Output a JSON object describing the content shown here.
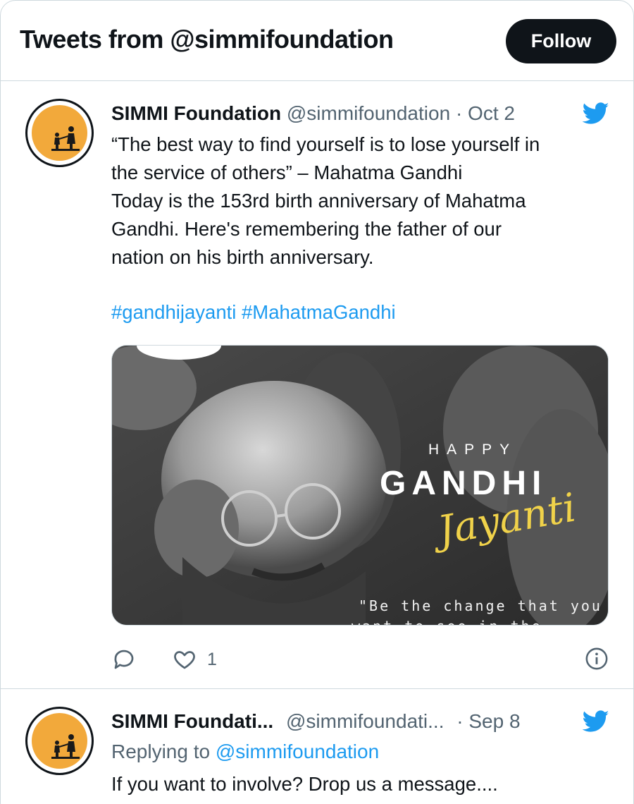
{
  "header": {
    "title": "Tweets from @simmifoundation",
    "follow_label": "Follow"
  },
  "tweets": [
    {
      "name": "SIMMI Foundation",
      "handle": "@simmifoundation",
      "separator": "·",
      "date": "Oct 2",
      "lines": [
        "“The best way to find yourself is to lose yourself in",
        "the service of others” – Mahatma Gandhi",
        "Today is the 153rd birth anniversary of Mahatma",
        "Gandhi. Here's remembering the father of our",
        "nation on his birth anniversary."
      ],
      "hashtags": [
        "#gandhijayanti",
        "#MahatmaGandhi"
      ],
      "media": {
        "happy": "HAPPY",
        "gandhi": "GANDHI",
        "jayanti": "Jayanti",
        "quote_line1": "\"Be the change that you",
        "quote_line2": "want to see in the world\""
      },
      "like_count": "1"
    },
    {
      "name": "SIMMI Foundati...",
      "handle": "@simmifoundati...",
      "separator": "·",
      "date": "Sep 8",
      "replying_prefix": "Replying to",
      "replying_to": "@simmifoundation",
      "lines": [
        "If you want to involve? Drop us a message...."
      ]
    }
  ],
  "icons": {
    "bird": "twitter-bird-icon",
    "reply": "reply-icon",
    "like": "heart-icon",
    "info": "info-icon"
  },
  "colors": {
    "accent": "#1d9bf0",
    "follow_bg": "#0f1419",
    "avatar_bg": "#f2a93b",
    "jayanti": "#f0d24a"
  }
}
